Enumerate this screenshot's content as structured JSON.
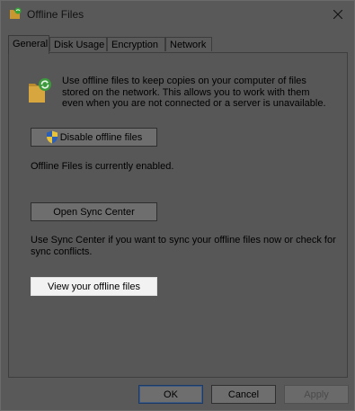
{
  "window": {
    "title": "Offline Files",
    "icon": "offline-files-icon",
    "close_icon": "close-icon"
  },
  "tabs": [
    {
      "label": "General",
      "active": true
    },
    {
      "label": "Disk Usage",
      "active": false
    },
    {
      "label": "Encryption",
      "active": false
    },
    {
      "label": "Network",
      "active": false
    }
  ],
  "general": {
    "description": "Use offline files to keep copies on your computer of files stored on the network.  This allows you to work with them even when you are not connected or a server is unavailable.",
    "disable_button": "Disable offline files",
    "status": "Offline Files is currently enabled.",
    "sync_center_button": "Open Sync Center",
    "sync_text": "Use Sync Center if you want to sync your offline files now or check for sync conflicts.",
    "view_button": "View your offline files"
  },
  "footer": {
    "ok": "OK",
    "cancel": "Cancel",
    "apply": "Apply"
  },
  "colors": {
    "folder": "#d6a23a",
    "sync_arrows": "#3aa33a",
    "shield_blue": "#2b5fb5",
    "shield_yellow": "#e8c23a"
  }
}
